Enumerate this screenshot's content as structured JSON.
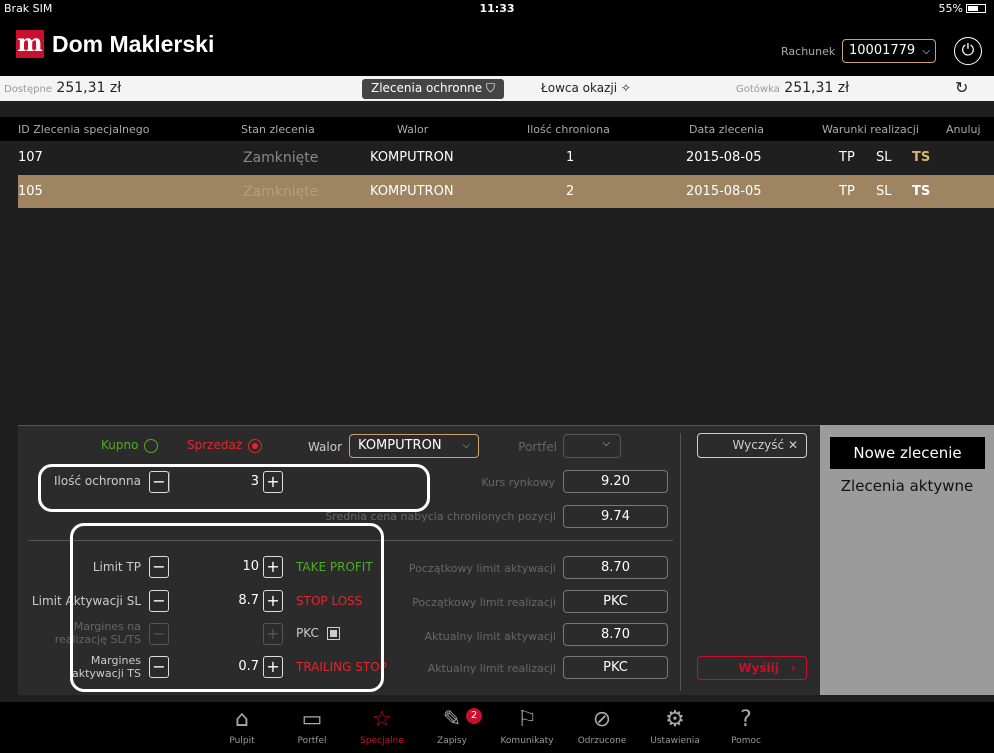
{
  "status": {
    "carrier": "Brak SIM",
    "time": "11:33",
    "battery": "55%"
  },
  "header": {
    "logo_letter": "m",
    "brand": "Dom Maklerski",
    "account_label": "Rachunek",
    "account_value": "10001779"
  },
  "balance": {
    "available_label": "Dostępne",
    "available_value": "251,31 zł",
    "tab_protective": "Zlecenia ochronne",
    "tab_hunter": "Łowca okazji",
    "cash_label": "Gotówka",
    "cash_value": "251,31 zł"
  },
  "table": {
    "headers": [
      "ID Zlecenia specjalnego",
      "Stan zlecenia",
      "Walor",
      "Ilość chroniona",
      "Data zlecenia",
      "Warunki realizacji",
      "Anuluj"
    ],
    "rows": [
      {
        "id": "107",
        "state": "Zamknięte",
        "asset": "KOMPUTRON",
        "qty": "1",
        "date": "2015-08-05",
        "tp": "TP",
        "sl": "SL",
        "ts": "TS"
      },
      {
        "id": "105",
        "state": "Zamknięte",
        "asset": "KOMPUTRON",
        "qty": "2",
        "date": "2015-08-05",
        "tp": "TP",
        "sl": "SL",
        "ts": "TS"
      }
    ]
  },
  "form": {
    "buy_label": "Kupno",
    "sell_label": "Sprzedaż",
    "asset_label": "Walor",
    "asset_value": "KOMPUTRON",
    "portfolio_label": "Portfel",
    "clear_label": "Wyczyść",
    "qty_label": "Ilość ochronna",
    "qty_value": "3",
    "market_label": "Kurs rynkowy",
    "market_value": "9.20",
    "avg_label": "Średnia cena nabycia chronionych pozycji",
    "avg_value": "9.74",
    "tp_label": "Limit TP",
    "tp_value": "10",
    "tp_name": "TAKE PROFIT",
    "sl_label": "Limit Aktywacji SL",
    "sl_value": "8.7",
    "sl_name": "STOP LOSS",
    "margin_label_1": "Margines na",
    "margin_label_2": "realizację SL/TS",
    "pkc_label": "PKC",
    "ts_label_1": "Margines",
    "ts_label_2": "aktywacji TS",
    "ts_value": "0.7",
    "ts_name": "TRAILING STOP",
    "init_act_label": "Początkowy limit aktywacji",
    "init_act_value": "8.70",
    "init_real_label": "Początkowy limit realizacji",
    "init_real_value": "PKC",
    "cur_act_label": "Aktualny limit aktywacji",
    "cur_act_value": "8.70",
    "cur_real_label": "Aktualny limit realizacji",
    "cur_real_value": "PKC",
    "send_label": "Wyślij"
  },
  "side": {
    "new_order": "Nowe zlecenie",
    "active_orders": "Zlecenia aktywne"
  },
  "nav": {
    "items": [
      {
        "label": "Pulpit",
        "icon": "home-icon"
      },
      {
        "label": "Portfel",
        "icon": "wallet-icon"
      },
      {
        "label": "Specjalne",
        "icon": "star-icon"
      },
      {
        "label": "Zapisy",
        "icon": "edit-icon"
      },
      {
        "label": "Komunikaty",
        "icon": "megaphone-icon"
      },
      {
        "label": "Odrzucone",
        "icon": "rejected-icon"
      },
      {
        "label": "Ustawienia",
        "icon": "gear-icon"
      },
      {
        "label": "Pomoc",
        "icon": "help-icon"
      }
    ],
    "zapisy_badge": "2"
  },
  "colors": {
    "brand_red": "#c8102e",
    "row_highlight": "#9e8461",
    "gold": "#d8b46a",
    "green": "#4cae1f"
  }
}
